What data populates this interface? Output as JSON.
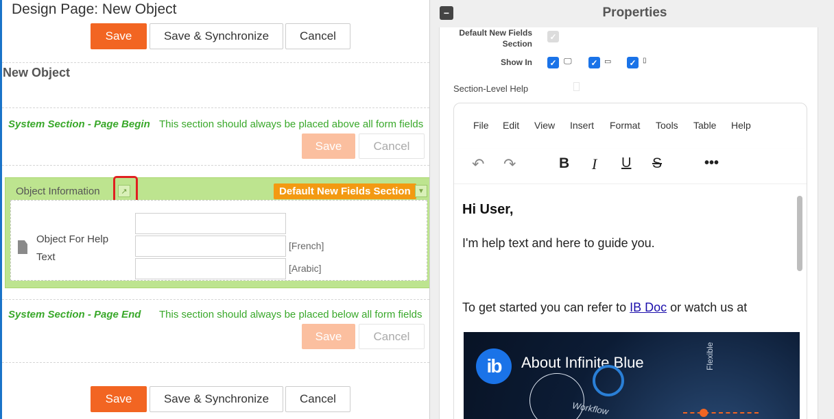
{
  "designer": {
    "page_title": "Design Page: New Object",
    "top_buttons": {
      "save": "Save",
      "save_sync": "Save & Synchronize",
      "cancel": "Cancel"
    },
    "object_title": "New Object",
    "section_begin": {
      "title": "System Section - Page Begin",
      "note": "This section should always be placed above all form fields",
      "save": "Save",
      "cancel": "Cancel"
    },
    "object_section": {
      "label": "Object Information",
      "badge": "Default New Fields Section",
      "field_label": "Object For Help Text",
      "langs": [
        "[French]",
        "[Arabic]"
      ]
    },
    "section_end": {
      "title": "System Section - Page End",
      "note": "This section should always be placed below all form fields",
      "save": "Save",
      "cancel": "Cancel"
    },
    "bottom_buttons": {
      "save": "Save",
      "save_sync": "Save & Synchronize",
      "cancel": "Cancel"
    }
  },
  "properties": {
    "title": "Properties",
    "default_fields_label": "Default New Fields Section",
    "show_in_label": "Show In",
    "show_in": {
      "desktop": true,
      "tablet": true,
      "mobile": true
    },
    "section_help_label": "Section-Level Help",
    "editor": {
      "menu": [
        "File",
        "Edit",
        "View",
        "Insert",
        "Format",
        "Tools",
        "Table",
        "Help"
      ],
      "content": {
        "heading": "Hi User,",
        "para1": "I'm help text and here to guide you.",
        "para2_prefix": "To get started you can refer to ",
        "para2_link": "IB Doc",
        "para2_suffix": " or watch us at",
        "video_title": "About Infinite Blue",
        "video_logo": "ib",
        "video_word1": "Workflow",
        "video_word2": "Flexible"
      }
    }
  },
  "colors": {
    "accent": "#f26522",
    "section_green": "#bde48f",
    "system_text": "#39a82a",
    "badge": "#f39a12",
    "link": "#1a0dab"
  }
}
